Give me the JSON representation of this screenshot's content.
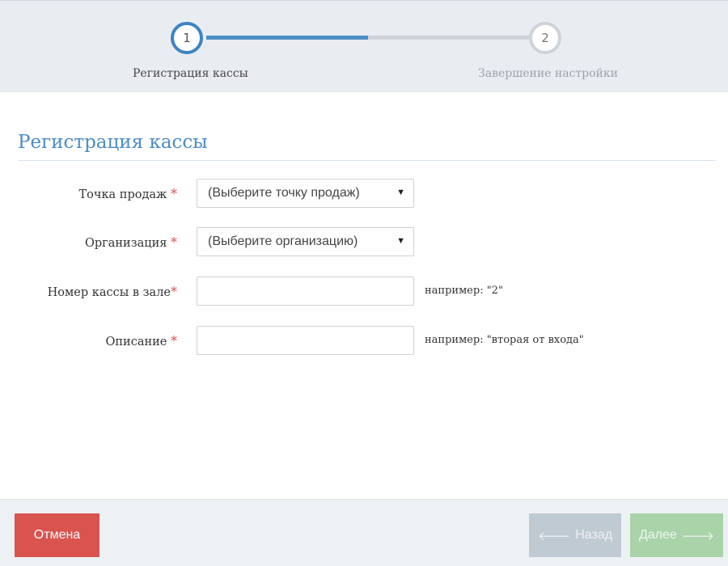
{
  "stepper": {
    "steps": [
      {
        "number": "1",
        "label": "Регистрация кассы",
        "state": "active"
      },
      {
        "number": "2",
        "label": "Завершение настройки",
        "state": "inactive"
      }
    ],
    "progress": 0.5
  },
  "section": {
    "title": "Регистрация кассы"
  },
  "form": {
    "sales_point": {
      "label": "Точка продаж",
      "required": "*",
      "value": "(Выберите точку продаж)"
    },
    "organization": {
      "label": "Организация",
      "required": "*",
      "value": "(Выберите организацию)"
    },
    "register_number": {
      "label": "Номер кассы в зале",
      "required": "*",
      "value": "",
      "hint": "например: \"2\""
    },
    "description": {
      "label": "Описание",
      "required": "*",
      "value": "",
      "hint": "например: \"вторая от входа\""
    }
  },
  "footer": {
    "cancel_label": "Отмена",
    "back_label": "Назад",
    "next_label": "Далее"
  },
  "colors": {
    "accent": "#4b8cc7",
    "cancel": "#d9534f",
    "back_disabled": "#bfcad3",
    "next_disabled": "#a9d3a9"
  },
  "icons": {
    "select_arrow": "caret-down-icon",
    "back": "arrow-left-icon",
    "next": "arrow-right-icon"
  }
}
